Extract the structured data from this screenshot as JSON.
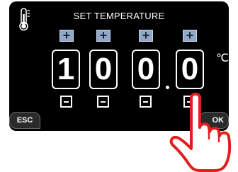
{
  "screen": {
    "title": "SET TEMPERATURE",
    "title_icon": "thermometer-icon"
  },
  "temperature": {
    "digits": [
      "1",
      "0",
      "0",
      "0"
    ],
    "unit": "℃",
    "increment_symbol": "+",
    "decrement_icon": "minus-icon",
    "decimal_separator_icon": "decimal-point"
  },
  "buttons": {
    "esc_label": "ESC",
    "ok_label": "OK"
  },
  "overlay": {
    "pointer_icon": "hand-pointer-icon"
  },
  "colors": {
    "screen_bg": "#000000",
    "plus_button": "#8fa8c8",
    "hand_outline": "#e02020",
    "text": "#ffffff"
  }
}
